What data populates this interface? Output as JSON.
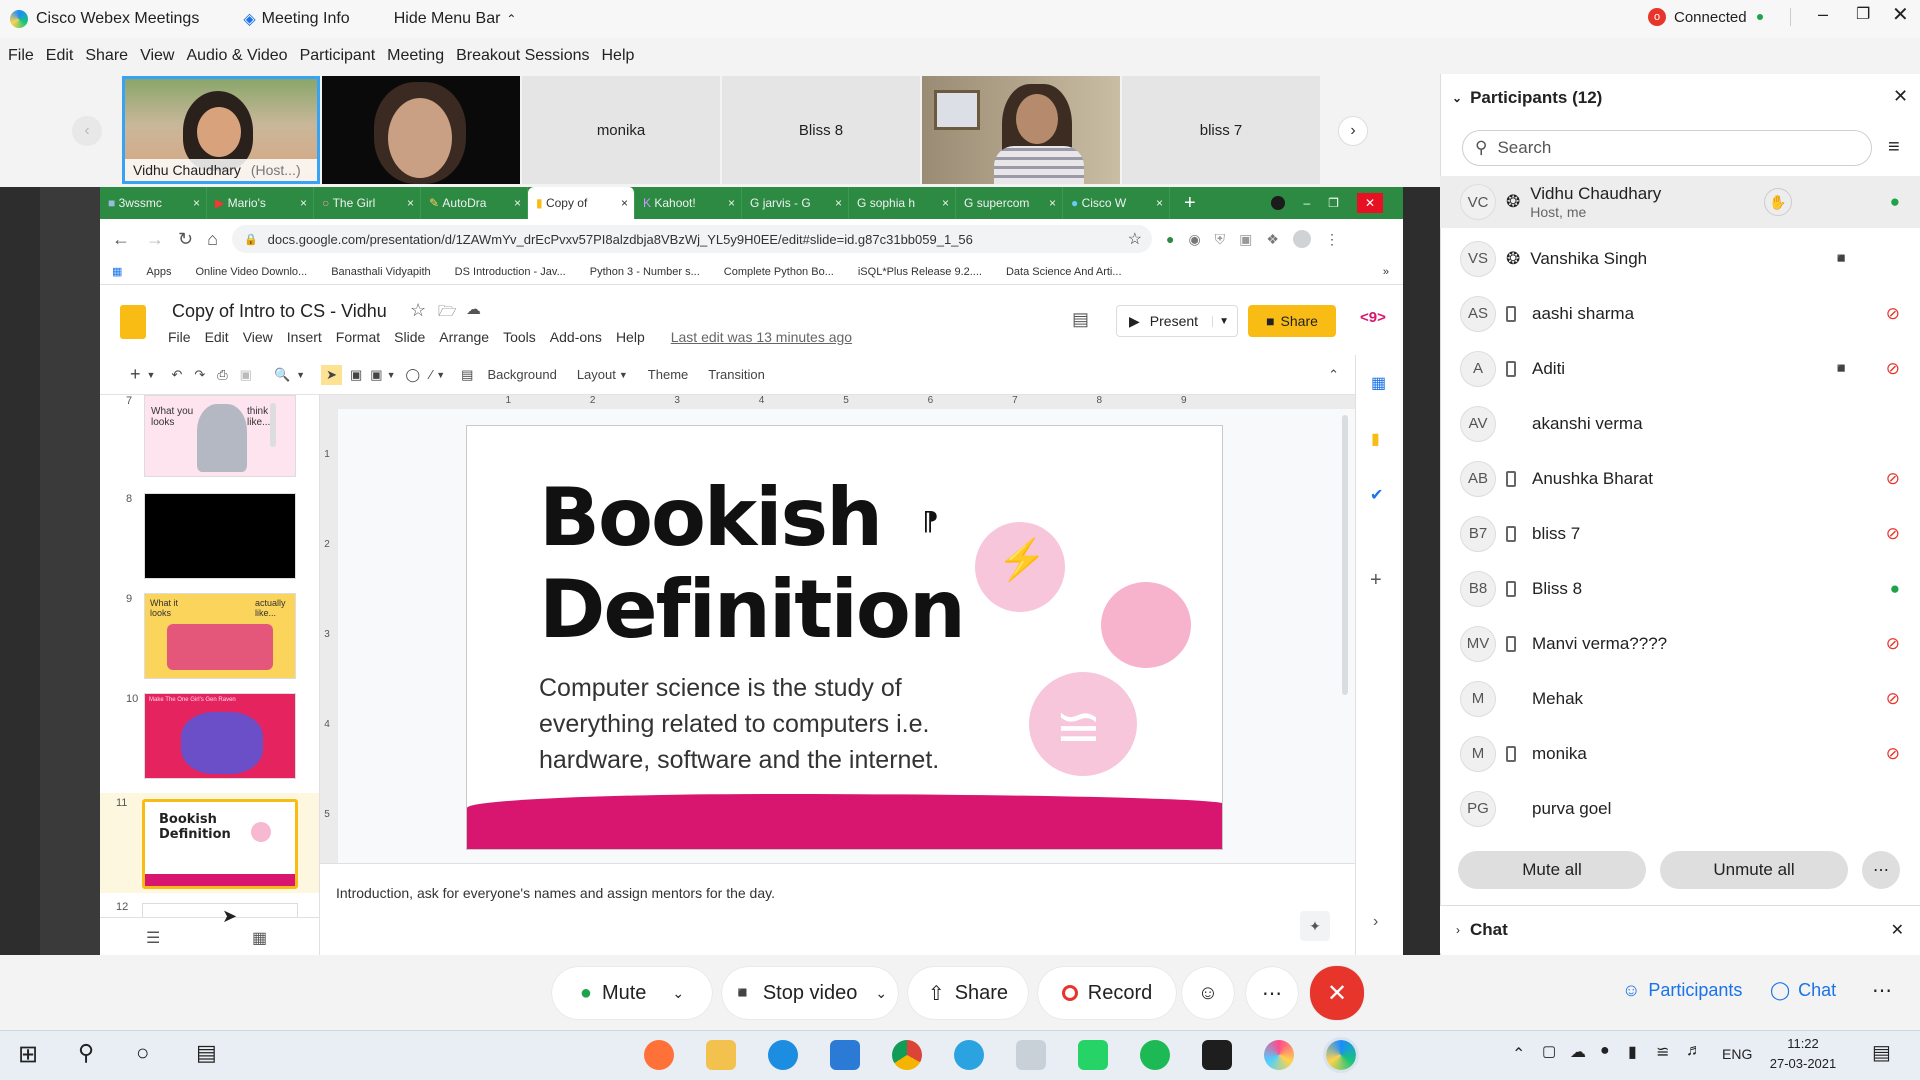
{
  "titlebar": {
    "app_name": "Cisco Webex Meetings",
    "meeting_info": "Meeting Info",
    "hide_menu": "Hide Menu Bar",
    "status": "Connected"
  },
  "menu": [
    "File",
    "Edit",
    "Share",
    "View",
    "Audio & Video",
    "Participant",
    "Meeting",
    "Breakout Sessions",
    "Help"
  ],
  "video_tiles": [
    {
      "name": "Vidhu Chaudhary",
      "tag": "(Host...)"
    },
    {
      "name": ""
    },
    {
      "name": "monika"
    },
    {
      "name": "Bliss 8"
    },
    {
      "name": ""
    },
    {
      "name": "bliss 7"
    }
  ],
  "browser": {
    "tabs": [
      "3wssmc",
      "Mario's",
      "The Girl",
      "AutoDra",
      "Copy of",
      "Kahoot!",
      "jarvis - G",
      "sophia h",
      "supercom",
      "Cisco W"
    ],
    "url": "docs.google.com/presentation/d/1ZAWmYv_drEcPvxv57PI8alzdbja8VBzWj_YL5y9H0EE/edit#slide=id.g87c31bb059_1_56",
    "bookmarks": [
      "Apps",
      "Online Video Downlo...",
      "Banasthali Vidyapith",
      "DS Introduction - Jav...",
      "Python 3 - Number s...",
      "Complete Python Bo...",
      "iSQL*Plus Release 9.2....",
      "Data Science And Arti..."
    ]
  },
  "slides": {
    "doc_title": "Copy of Intro to CS - Vidhu",
    "menu": [
      "File",
      "Edit",
      "View",
      "Insert",
      "Format",
      "Slide",
      "Arrange",
      "Tools",
      "Add-ons",
      "Help"
    ],
    "last_edit": "Last edit was 13 minutes ago",
    "present": "Present",
    "share": "Share",
    "toolbar": [
      "Background",
      "Layout",
      "Theme",
      "Transition"
    ],
    "filmstrip": [
      {
        "num": "7",
        "text1": "What you looks",
        "text2": "think it like....."
      },
      {
        "num": "8"
      },
      {
        "num": "9",
        "text1": "What it looks",
        "text2": "actually like..."
      },
      {
        "num": "10",
        "text1": "Make The One Girl's Gen Raven"
      },
      {
        "num": "11",
        "text1": "Bookish Definition"
      },
      {
        "num": "12"
      }
    ],
    "slide_title_1": "Bookish",
    "slide_title_2": "Definition",
    "slide_body": "Computer science is the study of everything related to computers i.e. hardware, software and the internet.",
    "notes": "Introduction, ask for everyone's names and assign mentors for the day.",
    "ruler": [
      "1",
      "2",
      "3",
      "4",
      "5",
      "6",
      "7",
      "8",
      "9"
    ],
    "vruler": [
      "1",
      "2",
      "3",
      "4",
      "5"
    ]
  },
  "participants_panel": {
    "title": "Participants (12)",
    "search_placeholder": "Search",
    "people": [
      {
        "initials": "VC",
        "name": "Vidhu Chaudhary",
        "sub": "Host, me"
      },
      {
        "initials": "VS",
        "name": "Vanshika Singh"
      },
      {
        "initials": "AS",
        "name": "aashi sharma"
      },
      {
        "initials": "A",
        "name": "Aditi"
      },
      {
        "initials": "AV",
        "name": "akanshi verma"
      },
      {
        "initials": "AB",
        "name": "Anushka Bharat"
      },
      {
        "initials": "B7",
        "name": "bliss 7"
      },
      {
        "initials": "B8",
        "name": "Bliss 8"
      },
      {
        "initials": "MV",
        "name": "Manvi verma????"
      },
      {
        "initials": "M",
        "name": "Mehak"
      },
      {
        "initials": "M",
        "name": "monika"
      },
      {
        "initials": "PG",
        "name": "purva goel"
      }
    ],
    "mute_all": "Mute all",
    "unmute_all": "Unmute all",
    "chat_title": "Chat"
  },
  "controls": {
    "mute": "Mute",
    "stop_video": "Stop video",
    "share": "Share",
    "record": "Record",
    "participants": "Participants",
    "chat": "Chat"
  },
  "taskbar": {
    "lang": "ENG",
    "time": "11:22",
    "date": "27-03-2021"
  },
  "colors": {
    "slides_yellow": "#f9bc15",
    "slide_pink": "#d9166f",
    "chrome_green": "#2c8a42",
    "end_red": "#e8352c"
  }
}
